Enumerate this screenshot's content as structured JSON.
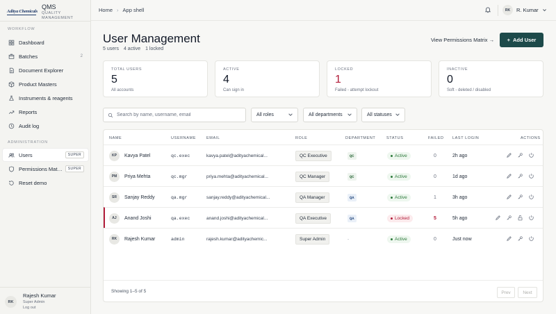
{
  "brand": {
    "logo_text": "Aditya Chemicals",
    "app": "QMS",
    "app_sub": "Quality Management"
  },
  "sidebar": {
    "workflow_label": "Workflow",
    "admin_label": "Administration",
    "workflow": [
      {
        "label": "Dashboard",
        "icon": "grid-icon",
        "count": ""
      },
      {
        "label": "Batches",
        "icon": "box-icon",
        "count": "2"
      },
      {
        "label": "Document Explorer",
        "icon": "document-icon",
        "count": ""
      },
      {
        "label": "Product Masters",
        "icon": "package-icon",
        "count": ""
      },
      {
        "label": "Instruments & reagents",
        "icon": "flask-icon",
        "count": ""
      },
      {
        "label": "Reports",
        "icon": "trend-icon",
        "count": ""
      },
      {
        "label": "Audit log",
        "icon": "clock-icon",
        "count": ""
      }
    ],
    "admin": [
      {
        "label": "Users",
        "icon": "users-icon",
        "tag": "SUPER",
        "active": true
      },
      {
        "label": "Permissions Mat…",
        "icon": "shield-icon",
        "tag": "SUPER"
      },
      {
        "label": "Reset demo",
        "icon": "reset-icon",
        "tag": ""
      }
    ],
    "user": {
      "initials": "RK",
      "name": "Rajesh Kumar",
      "role": "Super Admin",
      "logout": "Log out"
    }
  },
  "topbar": {
    "crumbs": [
      "Home",
      "App shell"
    ],
    "sep": "›",
    "user_initials": "RK",
    "user_name": "R. Kumar"
  },
  "page": {
    "title": "User Management",
    "stats": [
      "5 users",
      "4 active",
      "1 locked"
    ],
    "perm_link": "View Permissions Matrix →",
    "add_button": "Add User",
    "add_icon": "+"
  },
  "cards": [
    {
      "label": "Total users",
      "value": "5",
      "sub": "All accounts",
      "color": "#111827"
    },
    {
      "label": "Active",
      "value": "4",
      "sub": "Can sign in",
      "color": "#111827"
    },
    {
      "label": "Locked",
      "value": "1",
      "sub": "Failed - attempt lockout",
      "color": "#b21d3a"
    },
    {
      "label": "Inactive",
      "value": "0",
      "sub": "Soft - deleted / disabled",
      "color": "#111827"
    }
  ],
  "filters": {
    "search_placeholder": "Search by name, username, email",
    "roles": "All roles",
    "departments": "All departments",
    "statuses": "All statuses"
  },
  "table": {
    "headers": {
      "name": "Name",
      "username": "Username",
      "email": "Email",
      "role": "Role",
      "department": "Department",
      "status": "Status",
      "failed": "Failed",
      "last_login": "Last login",
      "actions": "Actions"
    },
    "rows": [
      {
        "initials": "KP",
        "name": "Kavya Patel",
        "username": "qc.exec",
        "email": "kavya.patel@adityachemical...",
        "role": "QC Executive",
        "dept": "QC",
        "status": "Active",
        "failed": "0",
        "last_login": "2h ago",
        "locked": false
      },
      {
        "initials": "PM",
        "name": "Priya Mehta",
        "username": "qc.mgr",
        "email": "priya.mehta@adityachemical...",
        "role": "QC Manager",
        "dept": "QC",
        "status": "Active",
        "failed": "0",
        "last_login": "1d ago",
        "locked": false
      },
      {
        "initials": "SR",
        "name": "Sanjay Reddy",
        "username": "qa.mgr",
        "email": "sanjay.reddy@adityachemical...",
        "role": "QA Manager",
        "dept": "QA",
        "status": "Active",
        "failed": "1",
        "last_login": "3h ago",
        "locked": false
      },
      {
        "initials": "AJ",
        "name": "Anand Joshi",
        "username": "qa.exec",
        "email": "anand.joshi@adityachemical...",
        "role": "QA Executive",
        "dept": "QA",
        "status": "Locked",
        "failed": "5",
        "last_login": "5h ago",
        "locked": true
      },
      {
        "initials": "RK",
        "name": "Rajesh Kumar",
        "username": "admin",
        "email": "rajesh.kumar@adityachemic...",
        "role": "Super Admin",
        "dept": "-",
        "status": "Active",
        "failed": "0",
        "last_login": "Just now",
        "locked": false
      }
    ],
    "footer": "Showing 1–5 of 5",
    "prev": "Prev",
    "next": "Next"
  }
}
